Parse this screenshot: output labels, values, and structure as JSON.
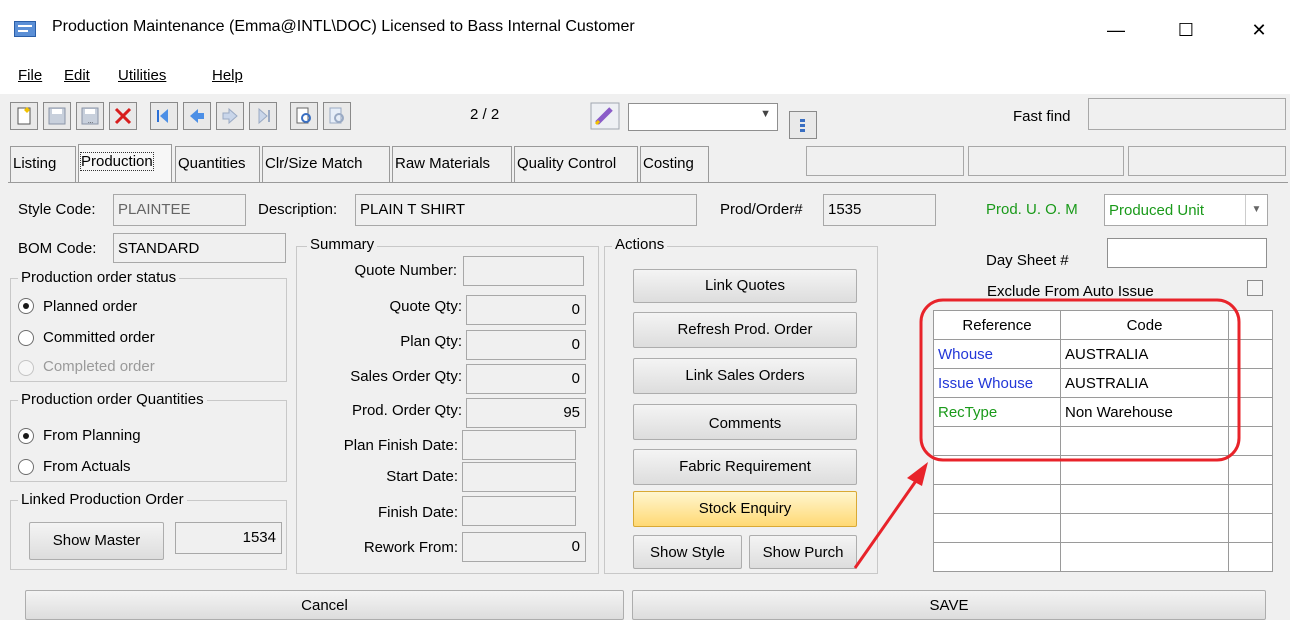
{
  "window": {
    "title": "Production Maintenance (Emma@INTL\\DOC) Licensed to Bass Internal Customer",
    "minimize": "—",
    "maximize": "☐",
    "close": "✕"
  },
  "menu": [
    "File",
    "Edit",
    "Utilities",
    "Help"
  ],
  "toolbar": {
    "record_position": "2 / 2",
    "fast_find_label": "Fast find",
    "fast_find_value": "",
    "combo_value": ""
  },
  "tabs": [
    "Listing",
    "Production",
    "Quantities",
    "Clr/Size Match",
    "Raw Materials",
    "Quality Control",
    "Costing"
  ],
  "header": {
    "style_code_label": "Style Code:",
    "style_code": "PLAINTEE",
    "description_label": "Description:",
    "description": "PLAIN T SHIRT",
    "prod_order_label": "Prod/Order#",
    "prod_order": "1535",
    "uom_label": "Prod. U. O. M",
    "uom_value": "Produced Unit",
    "bom_code_label": "BOM Code:",
    "bom_code": "STANDARD",
    "day_sheet_label": "Day Sheet #",
    "day_sheet_value": "",
    "exclude_label": "Exclude From Auto Issue"
  },
  "status_group": {
    "title": "Production order status",
    "options": [
      "Planned order",
      "Committed order",
      "Completed order"
    ]
  },
  "quantities_group": {
    "title": "Production order Quantities",
    "options": [
      "From Planning",
      "From Actuals"
    ]
  },
  "linked_group": {
    "title": "Linked Production Order",
    "button": "Show Master",
    "value": "1534"
  },
  "summary": {
    "title": "Summary",
    "rows": [
      {
        "label": "Quote Number:",
        "value": ""
      },
      {
        "label": "Quote Qty:",
        "value": "0"
      },
      {
        "label": "Plan Qty:",
        "value": "0"
      },
      {
        "label": "Sales Order Qty:",
        "value": "0"
      },
      {
        "label": "Prod. Order Qty:",
        "value": "95"
      },
      {
        "label": "Plan Finish Date:",
        "value": ""
      },
      {
        "label": "Start Date:",
        "value": ""
      },
      {
        "label": "Finish Date:",
        "value": ""
      },
      {
        "label": "Rework From:",
        "value": "0"
      }
    ]
  },
  "actions": {
    "title": "Actions",
    "buttons": [
      "Link Quotes",
      "Refresh Prod. Order",
      "Link Sales Orders",
      "Comments",
      "Fabric Requirement",
      "Stock Enquiry"
    ],
    "show_style": "Show Style",
    "show_purch": "Show Purch"
  },
  "ref_grid": {
    "headers": [
      "Reference",
      "Code"
    ],
    "rows": [
      {
        "reference": "Whouse",
        "code": "AUSTRALIA"
      },
      {
        "reference": "Issue Whouse",
        "code": "AUSTRALIA"
      },
      {
        "reference": "RecType",
        "code": "Non Warehouse"
      }
    ]
  },
  "bottom_buttons": [
    "Cancel",
    "SAVE"
  ],
  "colors": {
    "annotation": "#e8232a",
    "link_blue": "#2237d8",
    "link_green": "#1a9a1a",
    "highlight_button": "#ffd974"
  }
}
